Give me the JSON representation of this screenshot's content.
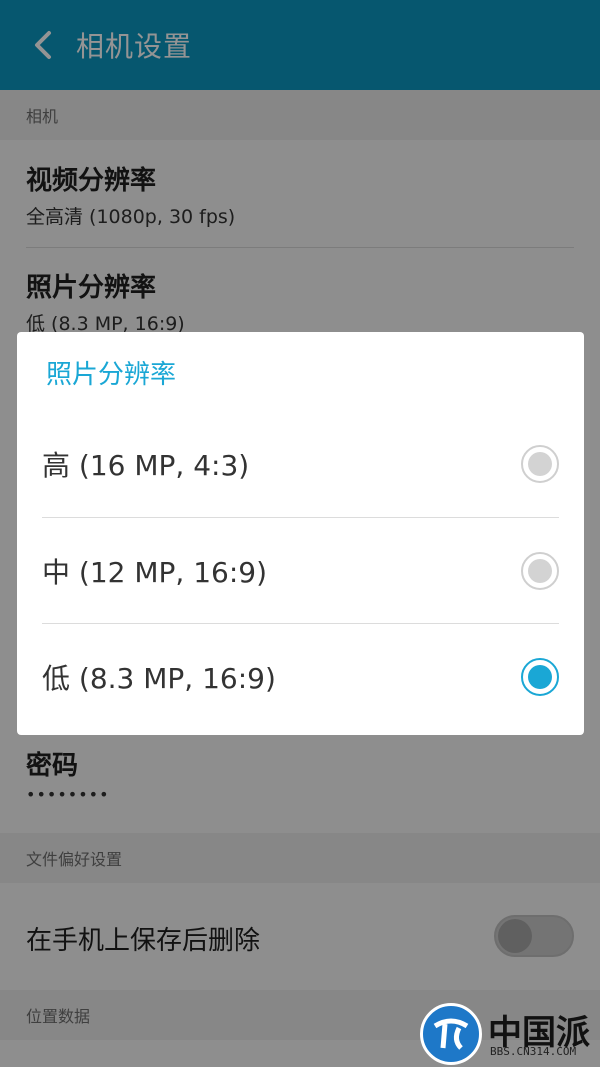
{
  "appbar": {
    "title": "相机设置"
  },
  "sections": {
    "camera": "相机",
    "file_prefs": "文件偏好设置",
    "location": "位置数据"
  },
  "prefs": {
    "video_resolution": {
      "title": "视频分辨率",
      "summary": "全高清 (1080p, 30 fps)"
    },
    "photo_resolution": {
      "title": "照片分辨率",
      "summary": "低 (8.3 MP, 16:9)"
    },
    "password": {
      "title": "密码",
      "summary": "••••••••"
    },
    "delete_after_save": {
      "title": "在手机上保存后删除",
      "enabled": false
    }
  },
  "dialog": {
    "title": "照片分辨率",
    "options": [
      {
        "label": "高 (16 MP, 4:3)",
        "selected": false
      },
      {
        "label": "中 (12 MP, 16:9)",
        "selected": false
      },
      {
        "label": "低 (8.3 MP, 16:9)",
        "selected": true
      }
    ]
  },
  "watermark": {
    "brand": "中国派",
    "url": "BBS.CN314.COM"
  },
  "colors": {
    "accent": "#1aa7d5",
    "appbar": "#0b96bf"
  }
}
